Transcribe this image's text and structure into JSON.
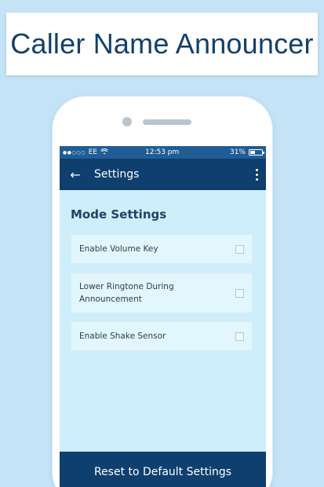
{
  "banner": {
    "title": "Caller Name Announcer"
  },
  "status_bar": {
    "signal": "●●○○○",
    "carrier": "EE",
    "wifi_icon": "wifi-icon",
    "time": "12:53 pm",
    "battery": "31%"
  },
  "app_bar": {
    "back_icon": "←",
    "title": "Settings",
    "more_icon": "more-vert-icon"
  },
  "section": {
    "title": "Mode Settings"
  },
  "settings": [
    {
      "label": "Enable Volume Key",
      "checked": false
    },
    {
      "label": "Lower Ringtone During Announcement",
      "checked": false
    },
    {
      "label": "Enable Shake Sensor",
      "checked": false
    }
  ],
  "reset": {
    "label": "Reset to Default Settings"
  },
  "colors": {
    "background": "#c4e3f6",
    "app_bar": "#0e3f6e",
    "status_bar": "#1f5d95",
    "screen": "#cfeefb",
    "banner_text": "#13406b"
  }
}
